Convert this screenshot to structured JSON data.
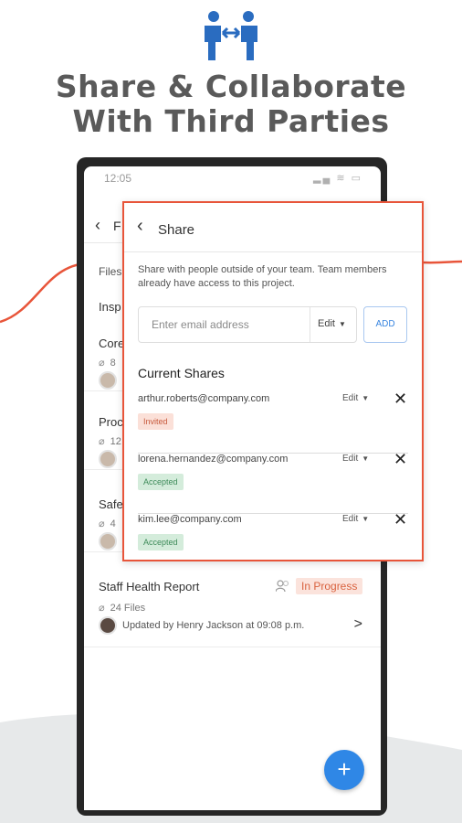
{
  "headline": {
    "line1": "Share & Collaborate",
    "line2": "With Third Parties"
  },
  "colors": {
    "accent": "#e8553a",
    "primary_blue": "#2f87e6",
    "headline": "#5a5a5a",
    "icon_blue": "#2a6cc0"
  },
  "phone": {
    "status_time": "12:05",
    "status_icons": "▂▄ ≋ ▭",
    "header_back": "‹",
    "header_title": "F",
    "files_tab": "Files",
    "insp_label": "Insp",
    "bg_rows": [
      {
        "title": "Core",
        "sub": "8"
      },
      {
        "title": "Proc",
        "sub": "12"
      },
      {
        "title": "Safe",
        "sub": "4"
      }
    ],
    "staff_report": {
      "title": "Staff Health Report",
      "status": "In Progress",
      "files": "24 Files",
      "updated": "Updated by Henry Jackson at 09:08 p.m."
    },
    "fab": "+"
  },
  "share": {
    "back": "‹",
    "title": "Share",
    "description": "Share with people outside of your team. Team members already have access to this project.",
    "email_placeholder": "Enter email address",
    "permission": "Edit",
    "add_label": "ADD",
    "current_title": "Current Shares",
    "remove_glyph": "✕",
    "shares": [
      {
        "email": "arthur.roberts@company.com",
        "permission": "Edit",
        "status": "Invited"
      },
      {
        "email": "lorena.hernandez@company.com",
        "permission": "Edit",
        "status": "Accepted"
      },
      {
        "email": "kim.lee@company.com",
        "permission": "Edit",
        "status": "Accepted"
      }
    ]
  }
}
